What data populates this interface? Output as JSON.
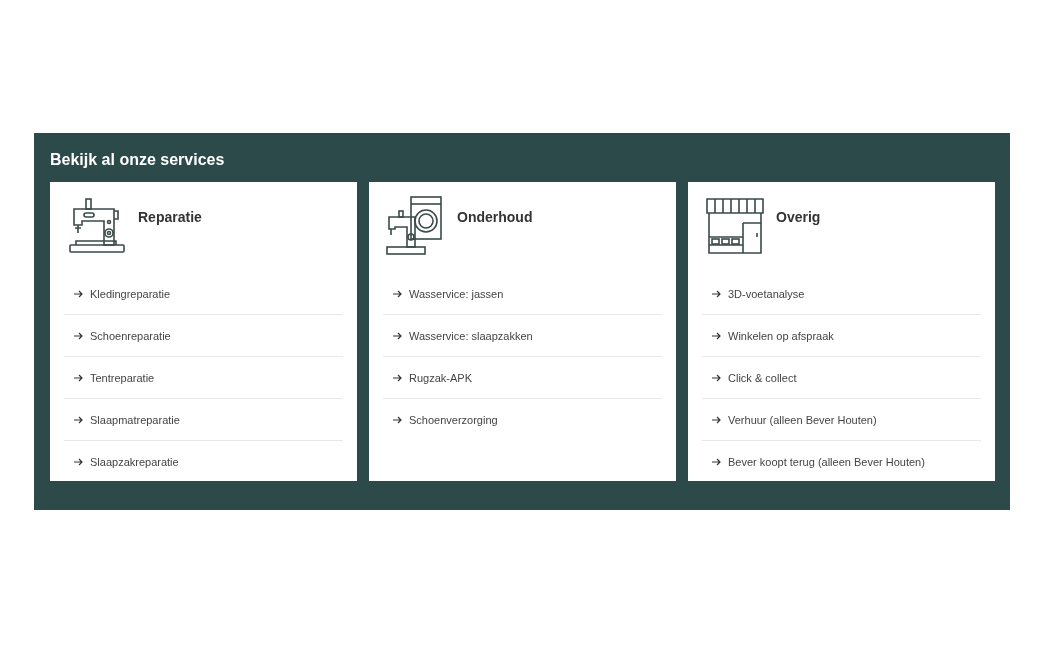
{
  "section": {
    "title": "Bekijk al onze services"
  },
  "cards": [
    {
      "kind": "sewing",
      "title": "Reparatie",
      "links": [
        "Kledingreparatie",
        "Schoenreparatie",
        "Tentreparatie",
        "Slaapmatreparatie",
        "Slaapzakreparatie"
      ]
    },
    {
      "kind": "washing",
      "title": "Onderhoud",
      "links": [
        "Wasservice: jassen",
        "Wasservice: slaapzakken",
        "Rugzak-APK",
        "Schoenverzorging"
      ]
    },
    {
      "kind": "shop",
      "title": "Overig",
      "links": [
        "3D-voetanalyse",
        "Winkelen op afspraak",
        "Click & collect",
        "Verhuur (alleen Bever Houten)",
        "Bever koopt terug (alleen Bever Houten)"
      ]
    }
  ]
}
